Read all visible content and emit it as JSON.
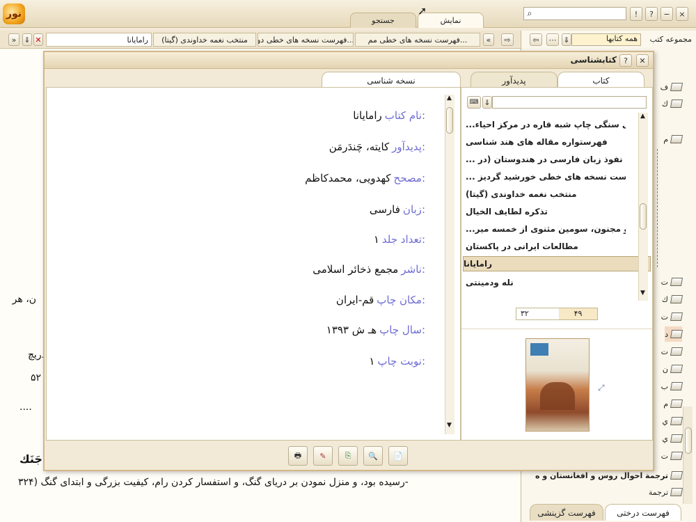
{
  "app": {
    "logo_text": "نور"
  },
  "top": {
    "tabs": [
      {
        "label": "نمایش"
      },
      {
        "label": "جستجو"
      }
    ],
    "search_placeholder": "",
    "window_buttons": [
      "!",
      "?",
      "−",
      "×"
    ]
  },
  "doc_tabs": [
    {
      "label": "رامایانا"
    },
    {
      "label": "منتخب نغمه خداوندی (گیتا)"
    },
    {
      "label": "فهرست نسخه های خطی دو..."
    },
    {
      "label": "فهرست نسخه های خطی مم..."
    }
  ],
  "sidebar": {
    "title": "مجموعه کتب",
    "filter_value": "همه کتابها",
    "bottom_tabs": [
      {
        "label": "فهرست درختی"
      },
      {
        "label": "فهرست گزینشی"
      }
    ],
    "rows": [
      {
        "label": "ف"
      },
      {
        "label": "ك"
      },
      {
        "label": "م"
      },
      {
        "label": ""
      },
      {
        "label": ""
      },
      {
        "label": ""
      },
      {
        "label": ""
      },
      {
        "label": ""
      },
      {
        "label": ""
      },
      {
        "label": ""
      },
      {
        "label": "ت"
      },
      {
        "label": "ك"
      },
      {
        "label": "ت"
      },
      {
        "label": "د"
      },
      {
        "label": "ت"
      },
      {
        "label": "ن"
      },
      {
        "label": "ب"
      },
      {
        "label": "م"
      },
      {
        "label": "ي"
      },
      {
        "label": "ي"
      },
      {
        "label": "ت"
      },
      {
        "label": "ت"
      },
      {
        "label": "ترجمة احوال روس و افغانستان و ه"
      },
      {
        "label": "ترجمة"
      }
    ]
  },
  "background_doc": {
    "line1": "ن، هر",
    "line2": "دریچ",
    "line3": "۵۲",
    "line4": "....",
    "line5": "جَنَك",
    "line6": "رسیده بود، و منزل نمودن بر دریای گنگ، و استفسار کردن رام، کیفیت بزرگی و ابتدای گنگ (۳۲۴-"
  },
  "dialog": {
    "title": "کتابشناسی",
    "left_tab": "نسخه شناسی",
    "right_tabs": [
      {
        "label": "کتاب"
      },
      {
        "label": "پدیدآور"
      }
    ],
    "fields": [
      {
        "label": "نام کتاب:",
        "value": "رامایانا"
      },
      {
        "label": "پدیدآور:",
        "value": "کایته، چَندَرمَن"
      },
      {
        "label": "مصحح:",
        "value": "کهدویی، محمدکاظم"
      },
      {
        "label": "زبان:",
        "value": "فارسی"
      },
      {
        "label": "تعداد جلد:",
        "value": "۱"
      },
      {
        "label": "ناشر:",
        "value": "مجمع ذخائر اسلامی"
      },
      {
        "label": "مکان چاپ:",
        "value": "قم-ایران"
      },
      {
        "label": "سال چاپ:",
        "value": "۱۳۹۳ هـ ش"
      },
      {
        "label": "نوبت چاپ:",
        "value": "۱"
      }
    ],
    "book_list": [
      {
        "label": "کتابهای سنگی چاپ شبه قاره در مرکز احیاء..."
      },
      {
        "label": "فهرستواره مقاله های هند شناسی"
      },
      {
        "label": "کاهش نفوذ زبان فارسی در هندوستان (در ..."
      },
      {
        "label": "فهرست نسخه های خطی خورشید گردیز ..."
      },
      {
        "label": "منتخب نغمه خداوندی (گیتا)"
      },
      {
        "label": "تذکره لطایف الخیال"
      },
      {
        "label": "لیلی و مجنون، سومین مثنوی از خمسه میر..."
      },
      {
        "label": "مطالعات ایرانی در پاکستان"
      },
      {
        "label": "رامایانا",
        "selected": true
      },
      {
        "label": "نله ودمینتی"
      }
    ],
    "pager": {
      "current": "۴۹",
      "total": "۳۲"
    },
    "toolbar": [
      "print",
      "edit",
      "export",
      "zoom",
      "note"
    ]
  }
}
